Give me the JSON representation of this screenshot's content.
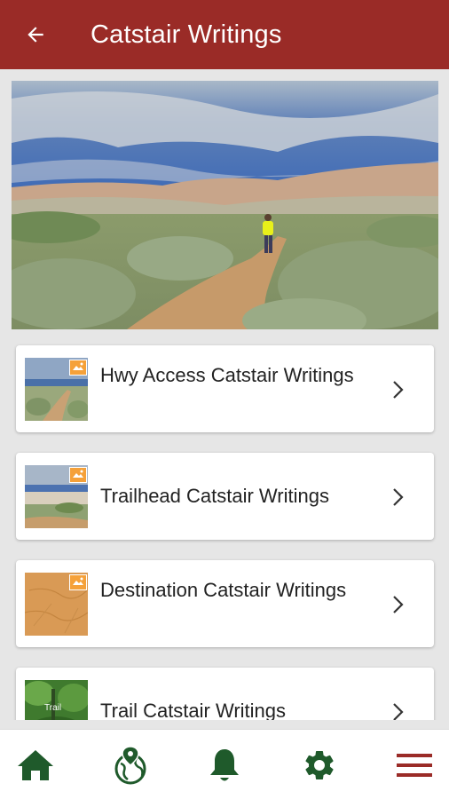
{
  "appbar": {
    "title": "Catstair Writings",
    "background_color": "#9a2b27",
    "back_icon": "arrow-left-icon"
  },
  "hero": {
    "image": "desert-trail-hiker-photo"
  },
  "items": [
    {
      "label": "Hwy Access Catstair Writings",
      "thumbnail": "highway-access-photo",
      "badge_icon": "360-photo-icon",
      "chevron_icon": "chevron-right-icon"
    },
    {
      "label": "Trailhead Catstair Writings",
      "thumbnail": "trailhead-photo",
      "badge_icon": "360-photo-icon",
      "chevron_icon": "chevron-right-icon"
    },
    {
      "label": "Destination Catstair Writings",
      "thumbnail": "sandstone-photo",
      "badge_icon": "360-photo-icon",
      "chevron_icon": "chevron-right-icon"
    },
    {
      "label": "Trail Catstair Writings",
      "thumbnail": "trail-video-thumbnail",
      "thumbnail_caption": "Trail",
      "chevron_icon": "chevron-right-icon"
    }
  ],
  "bottom_nav": {
    "icon_color": "#1f5a2b",
    "menu_color": "#9a2b27",
    "items": [
      "home-icon",
      "map-globe-icon",
      "bell-icon",
      "gear-icon",
      "menu-icon"
    ]
  }
}
